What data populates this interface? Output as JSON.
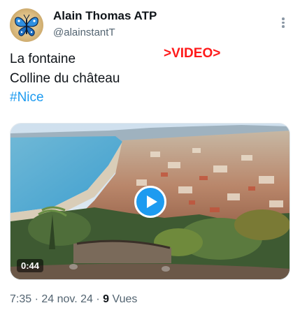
{
  "author": {
    "display_name": "Alain Thomas ATP",
    "handle": "@alainstantT",
    "avatar_icon": "butterfly-avatar-icon"
  },
  "more_icon": "more-options-icon",
  "tweet": {
    "lines": [
      "La fontaine",
      "Colline du château"
    ],
    "hashtag": "#Nice",
    "overlay_label": ">VIDEO>",
    "overlay_color": "#ff1a1a"
  },
  "video": {
    "duration": "0:44",
    "play_icon": "play-icon",
    "accent": "#1d9bf0"
  },
  "meta": {
    "time": "7:35",
    "separator": "·",
    "date": "24 nov. 24",
    "views_count": "9",
    "views_label": "Vues"
  }
}
